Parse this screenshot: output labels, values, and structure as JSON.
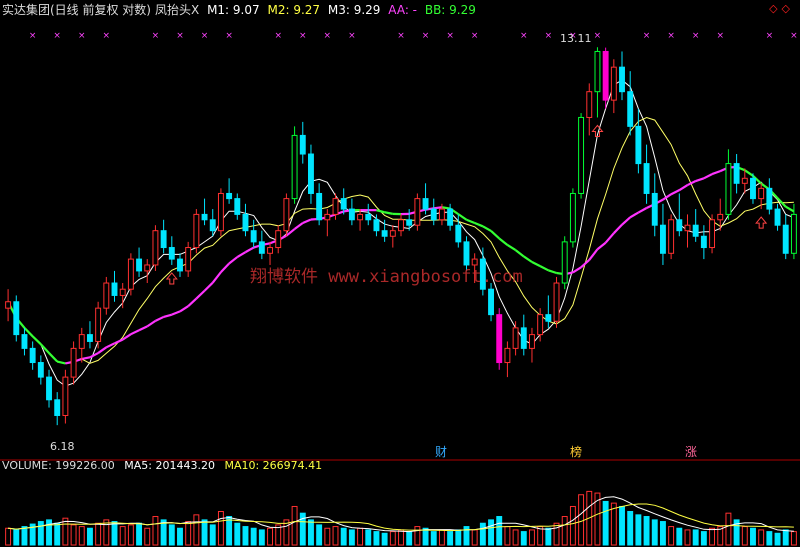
{
  "header": {
    "title": "实达集团(日线 前复权 对数)",
    "indicator": "凤抬头X",
    "m1": "M1: 9.07",
    "m2": "M2: 9.27",
    "m3": "M3: 9.29",
    "aa": "AA: -",
    "bb": "BB: 9.29"
  },
  "volume_header": {
    "label": "VOLUME: 199226.00",
    "ma5": "MA5: 201443.20",
    "ma10": "MA10: 266974.41"
  },
  "watermark": "翔博软件 www.xiangbosoft.com",
  "markers": {
    "cai": "财",
    "bang": "榜",
    "zhang": "涨"
  },
  "annotations": {
    "high": "13.11",
    "low": "6.18"
  },
  "colors": {
    "up": "#ff3030",
    "down": "#00e5ff",
    "limit_up": "#00ff33",
    "limit_down": "#ff00cc",
    "ma_white": "#ffffff",
    "ma_yellow": "#ffff66",
    "ma_magenta": "#ff33ff",
    "ma_green": "#33ff33",
    "x_marks": "#ff44ff"
  },
  "chart_data": {
    "type": "candlestick",
    "y_scale": "log",
    "ylim": [
      6.0,
      13.3
    ],
    "candles": [
      [
        7.8,
        8.1,
        7.6,
        7.9
      ],
      [
        7.9,
        8.0,
        7.3,
        7.4
      ],
      [
        7.4,
        7.5,
        7.1,
        7.2
      ],
      [
        7.2,
        7.3,
        6.9,
        7.0
      ],
      [
        7.0,
        7.1,
        6.7,
        6.8
      ],
      [
        6.8,
        6.9,
        6.4,
        6.5
      ],
      [
        6.5,
        6.6,
        6.18,
        6.3
      ],
      [
        6.3,
        6.9,
        6.2,
        6.8
      ],
      [
        6.8,
        7.3,
        6.7,
        7.2
      ],
      [
        7.2,
        7.5,
        7.0,
        7.4
      ],
      [
        7.4,
        7.6,
        7.2,
        7.3
      ],
      [
        7.3,
        7.9,
        7.2,
        7.8
      ],
      [
        7.8,
        8.3,
        7.7,
        8.2
      ],
      [
        8.2,
        8.4,
        7.9,
        8.0
      ],
      [
        8.0,
        8.2,
        7.8,
        8.1
      ],
      [
        8.1,
        8.7,
        8.0,
        8.6
      ],
      [
        8.6,
        8.8,
        8.3,
        8.4
      ],
      [
        8.4,
        8.6,
        8.2,
        8.5
      ],
      [
        8.5,
        9.2,
        8.4,
        9.1
      ],
      [
        9.1,
        9.3,
        8.7,
        8.8
      ],
      [
        8.8,
        9.0,
        8.5,
        8.6
      ],
      [
        8.6,
        8.7,
        8.3,
        8.4
      ],
      [
        8.4,
        8.9,
        8.3,
        8.8
      ],
      [
        8.8,
        9.5,
        8.7,
        9.4
      ],
      [
        9.4,
        9.7,
        9.2,
        9.3
      ],
      [
        9.3,
        9.5,
        9.0,
        9.1
      ],
      [
        9.1,
        9.9,
        9.0,
        9.8
      ],
      [
        9.8,
        10.1,
        9.6,
        9.7
      ],
      [
        9.7,
        9.8,
        9.3,
        9.4
      ],
      [
        9.4,
        9.6,
        9.0,
        9.1
      ],
      [
        9.1,
        9.3,
        8.8,
        8.9
      ],
      [
        8.9,
        9.1,
        8.6,
        8.7
      ],
      [
        8.7,
        8.9,
        8.5,
        8.8
      ],
      [
        8.8,
        9.2,
        8.7,
        9.1
      ],
      [
        9.1,
        9.8,
        9.0,
        9.7
      ],
      [
        9.7,
        11.2,
        9.6,
        11.0
      ],
      [
        11.0,
        11.3,
        10.4,
        10.6
      ],
      [
        10.6,
        10.8,
        9.6,
        9.8
      ],
      [
        9.8,
        10.0,
        9.2,
        9.3
      ],
      [
        9.3,
        9.5,
        9.0,
        9.4
      ],
      [
        9.4,
        9.8,
        9.3,
        9.7
      ],
      [
        9.7,
        9.9,
        9.4,
        9.5
      ],
      [
        9.5,
        9.7,
        9.2,
        9.3
      ],
      [
        9.3,
        9.5,
        9.1,
        9.4
      ],
      [
        9.4,
        9.6,
        9.2,
        9.3
      ],
      [
        9.3,
        9.4,
        9.0,
        9.1
      ],
      [
        9.1,
        9.3,
        8.9,
        9.0
      ],
      [
        9.0,
        9.2,
        8.8,
        9.1
      ],
      [
        9.1,
        9.4,
        9.0,
        9.3
      ],
      [
        9.3,
        9.5,
        9.1,
        9.2
      ],
      [
        9.2,
        9.8,
        9.1,
        9.7
      ],
      [
        9.7,
        10.0,
        9.4,
        9.5
      ],
      [
        9.5,
        9.7,
        9.2,
        9.3
      ],
      [
        9.3,
        9.6,
        9.2,
        9.5
      ],
      [
        9.5,
        9.6,
        9.1,
        9.2
      ],
      [
        9.2,
        9.4,
        8.8,
        8.9
      ],
      [
        8.9,
        9.0,
        8.4,
        8.5
      ],
      [
        8.5,
        8.7,
        8.2,
        8.6
      ],
      [
        8.6,
        8.8,
        8.0,
        8.1
      ],
      [
        8.1,
        8.2,
        7.6,
        7.7
      ],
      [
        7.7,
        7.8,
        6.9,
        7.0
      ],
      [
        7.0,
        7.3,
        6.8,
        7.2
      ],
      [
        7.2,
        7.6,
        7.1,
        7.5
      ],
      [
        7.5,
        7.7,
        7.1,
        7.2
      ],
      [
        7.2,
        7.5,
        7.0,
        7.4
      ],
      [
        7.4,
        7.8,
        7.3,
        7.7
      ],
      [
        7.7,
        8.0,
        7.5,
        7.6
      ],
      [
        7.6,
        8.3,
        7.5,
        8.2
      ],
      [
        8.2,
        9.0,
        8.1,
        8.9
      ],
      [
        8.9,
        9.9,
        8.8,
        9.8
      ],
      [
        9.8,
        11.5,
        9.7,
        11.4
      ],
      [
        11.4,
        12.2,
        11.0,
        12.0
      ],
      [
        12.0,
        13.11,
        11.4,
        13.0
      ],
      [
        13.0,
        13.1,
        11.6,
        11.8
      ],
      [
        11.8,
        12.8,
        11.5,
        12.6
      ],
      [
        12.6,
        13.0,
        11.8,
        12.0
      ],
      [
        12.0,
        12.5,
        11.0,
        11.2
      ],
      [
        11.2,
        11.6,
        10.2,
        10.4
      ],
      [
        10.4,
        10.8,
        9.6,
        9.8
      ],
      [
        9.8,
        10.2,
        9.0,
        9.2
      ],
      [
        9.2,
        9.6,
        8.5,
        8.7
      ],
      [
        8.7,
        9.4,
        8.6,
        9.3
      ],
      [
        9.3,
        9.8,
        9.0,
        9.1
      ],
      [
        9.1,
        9.4,
        8.8,
        9.2
      ],
      [
        9.2,
        9.5,
        8.9,
        9.0
      ],
      [
        9.0,
        9.2,
        8.6,
        8.8
      ],
      [
        8.8,
        9.4,
        8.7,
        9.3
      ],
      [
        9.3,
        9.7,
        9.1,
        9.4
      ],
      [
        9.4,
        10.7,
        9.3,
        10.4
      ],
      [
        10.4,
        10.6,
        9.8,
        10.0
      ],
      [
        10.0,
        10.3,
        9.8,
        10.1
      ],
      [
        10.1,
        10.2,
        9.6,
        9.7
      ],
      [
        9.7,
        10.0,
        9.5,
        9.9
      ],
      [
        9.9,
        10.1,
        9.4,
        9.5
      ],
      [
        9.5,
        9.6,
        9.1,
        9.2
      ],
      [
        9.2,
        9.4,
        8.6,
        8.7
      ],
      [
        8.7,
        9.6,
        8.6,
        9.4
      ]
    ],
    "volume_ylim": [
      0,
      80
    ],
    "volumes": [
      20,
      18,
      22,
      25,
      28,
      30,
      26,
      32,
      24,
      22,
      20,
      26,
      30,
      28,
      22,
      24,
      26,
      20,
      34,
      30,
      24,
      20,
      28,
      36,
      30,
      24,
      40,
      34,
      26,
      22,
      20,
      18,
      20,
      24,
      30,
      46,
      38,
      30,
      24,
      20,
      22,
      20,
      18,
      20,
      18,
      16,
      14,
      16,
      18,
      16,
      22,
      20,
      16,
      18,
      16,
      18,
      22,
      18,
      26,
      30,
      34,
      22,
      18,
      16,
      18,
      22,
      20,
      26,
      34,
      46,
      60,
      64,
      62,
      52,
      50,
      46,
      40,
      36,
      34,
      30,
      28,
      22,
      20,
      18,
      18,
      16,
      20,
      22,
      38,
      30,
      22,
      20,
      18,
      16,
      14,
      18,
      16
    ]
  }
}
